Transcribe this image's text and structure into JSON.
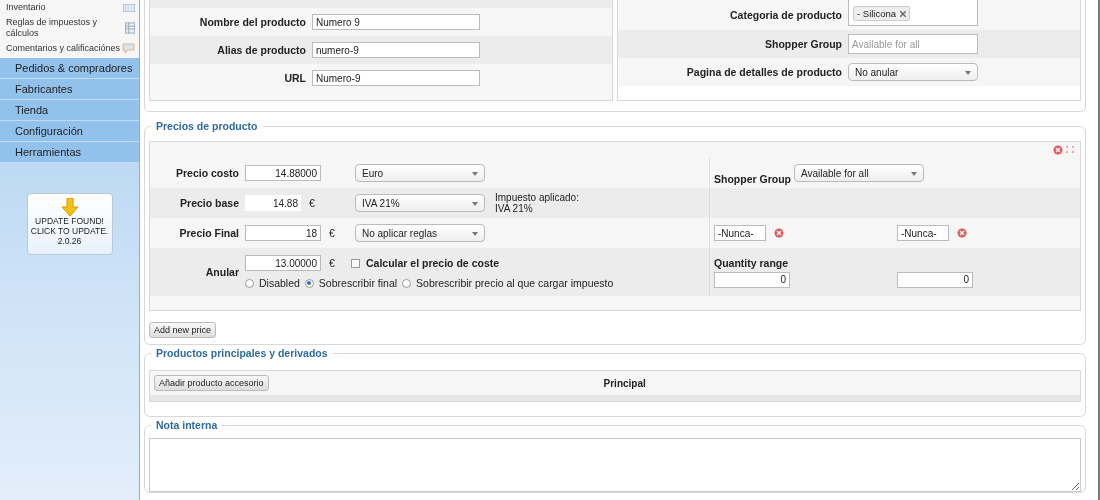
{
  "sidebar": {
    "sub_items": [
      {
        "label": "Inventario",
        "kind": "list"
      },
      {
        "label": "Reglas de impuestos y cálculos",
        "kind": "table"
      },
      {
        "label": "Comentarios y calificaciónes",
        "kind": "chat"
      }
    ],
    "menu": [
      "Pedidos & compradores",
      "Fabricantes",
      "Tienda",
      "Configuración",
      "Herramientas"
    ],
    "update": {
      "lines": [
        "UPDATE FOUND!",
        "CLICK TO UPDATE.",
        "2.0.26"
      ]
    }
  },
  "product_info": {
    "left_rows": [
      {
        "label": "Nombre del producto",
        "value": "Numero 9"
      },
      {
        "label": "Alias de producto",
        "value": "numero-9"
      },
      {
        "label": "URL",
        "value": "Numero-9"
      }
    ],
    "category": {
      "label": "Categoria de producto",
      "tags": [
        "- Silicona"
      ]
    },
    "shopper_group": {
      "label": "Shopper Group",
      "placeholder": "Available for all"
    },
    "detail_page": {
      "label": "Pagina de detalles de producto",
      "value": "No anular"
    }
  },
  "prices": {
    "legend": "Precios de producto",
    "cost": {
      "label": "Precio costo",
      "value": "14.88000",
      "currency": "Euro"
    },
    "base": {
      "label": "Precio base",
      "value": "14.88",
      "unit": "€",
      "tax": "IVA 21%",
      "tax_note": [
        "Impuesto aplicado:",
        "IVA 21%"
      ]
    },
    "final": {
      "label": "Precio Final",
      "value": "18",
      "unit": "€",
      "rule": "No aplicar reglas"
    },
    "override": {
      "label": "Anular",
      "value": "13.00000",
      "unit": "€",
      "calc_label": "Calcular el precio de coste",
      "calc_checked": false,
      "options": [
        {
          "label": "Disabled",
          "selected": false
        },
        {
          "label": "Sobrescribir final",
          "selected": true
        },
        {
          "label": "Sobrescribir precio al que cargar impuesto",
          "selected": false
        }
      ]
    },
    "shopper_group": {
      "label": "Shopper Group",
      "value": "Available for all"
    },
    "dates": [
      "-Nunca-",
      "-Nunca-"
    ],
    "quantity": {
      "label": "Quantity range",
      "values": [
        "0",
        "0"
      ]
    },
    "add_button": "Add new price"
  },
  "related": {
    "legend": "Productos principales y derivados",
    "button": "Añadir producto accesorio",
    "header": "Principal"
  },
  "note": {
    "legend": "Nota interna"
  }
}
